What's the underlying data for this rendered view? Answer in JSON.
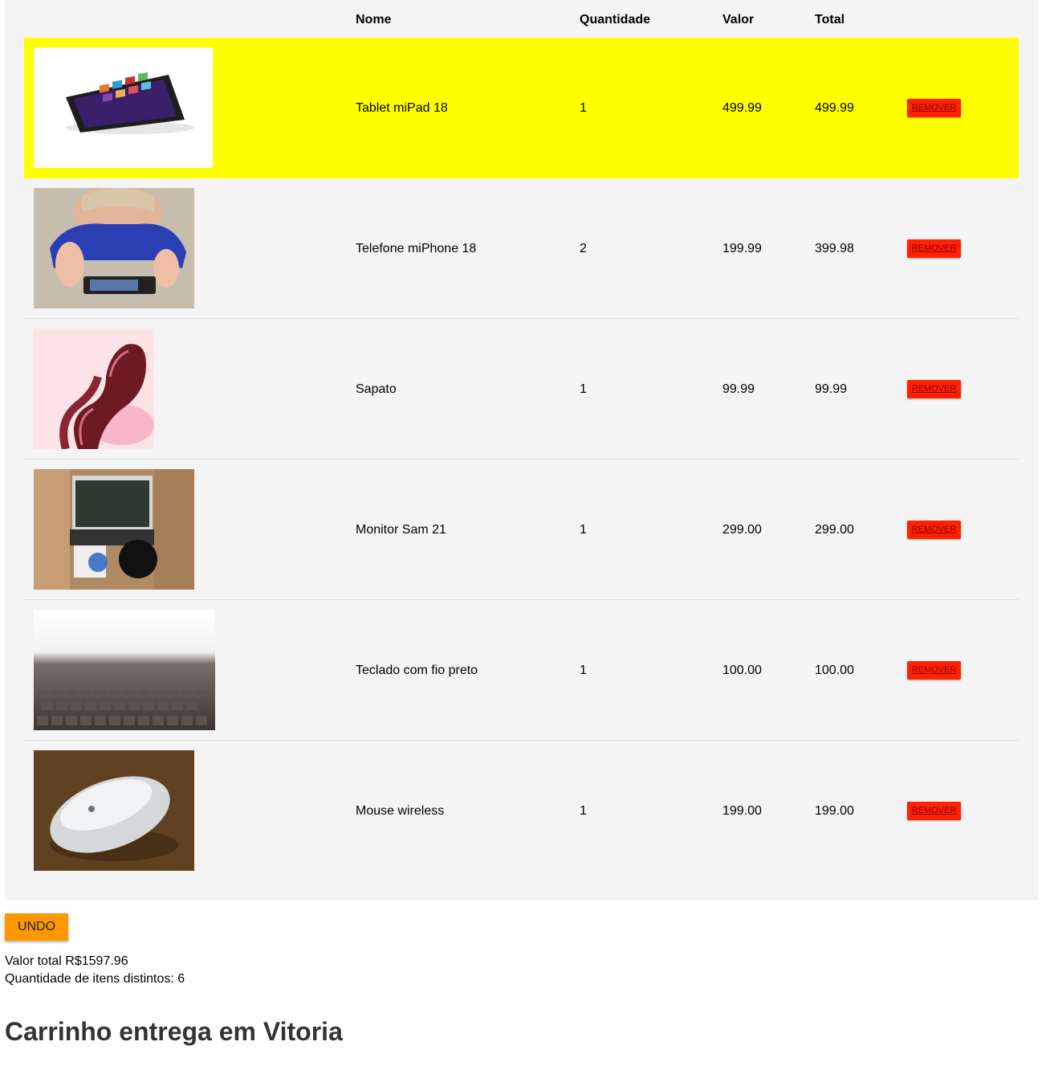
{
  "table": {
    "headers": {
      "nome": "Nome",
      "quantidade": "Quantidade",
      "valor": "Valor",
      "total": "Total"
    },
    "rows": [
      {
        "nome": "Tablet miPad 18",
        "quantidade": "1",
        "valor": "499.99",
        "total": "499.99",
        "remover": "REMOVER",
        "image": "tablet-image",
        "highlighted": true
      },
      {
        "nome": "Telefone miPhone 18",
        "quantidade": "2",
        "valor": "199.99",
        "total": "399.98",
        "remover": "REMOVER",
        "image": "phone-image"
      },
      {
        "nome": "Sapato",
        "quantidade": "1",
        "valor": "99.99",
        "total": "99.99",
        "remover": "REMOVER",
        "image": "shoe-image"
      },
      {
        "nome": "Monitor Sam 21",
        "quantidade": "1",
        "valor": "299.00",
        "total": "299.00",
        "remover": "REMOVER",
        "image": "monitor-image"
      },
      {
        "nome": "Teclado com fio preto",
        "quantidade": "1",
        "valor": "100.00",
        "total": "100.00",
        "remover": "REMOVER",
        "image": "keyboard-image"
      },
      {
        "nome": "Mouse wireless",
        "quantidade": "1",
        "valor": "199.00",
        "total": "199.00",
        "remover": "REMOVER",
        "image": "mouse-image"
      }
    ]
  },
  "undo_label": "UNDO",
  "summary": {
    "valor_total": "Valor total R$1597.96",
    "quantidade_itens": "Quantidade de itens distintos: 6"
  },
  "section_title": "Carrinho entrega em Vitoria",
  "colors": {
    "highlight": "#ffff00",
    "remove_button": "#ff2200",
    "undo_button": "#ff9800",
    "panel": "#f4f4f4"
  }
}
